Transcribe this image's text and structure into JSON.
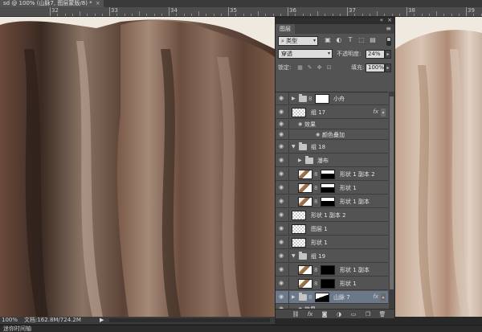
{
  "document_tab": {
    "title": "sd @ 100% (山脉7, 图层蒙版/8) *",
    "close": "×"
  },
  "ruler": {
    "labels": [
      "32",
      "33",
      "34",
      "35",
      "36",
      "37",
      "38",
      "39"
    ]
  },
  "status": {
    "zoom": "100%",
    "doc_info": "文档:162.8M/724.2M",
    "arrow": "▶"
  },
  "bottom_tabs": [
    "迷你",
    "时间轴"
  ],
  "layers_panel": {
    "tab_label": "图层",
    "menu_icon": "≡",
    "filter": {
      "kind_label": "类型",
      "icons": [
        "image-filter-icon",
        "adjustment-filter-icon",
        "text-filter-icon",
        "shape-filter-icon",
        "smart-object-filter-icon"
      ]
    },
    "blend_mode": "穿透",
    "opacity_label": "不透明度:",
    "opacity_value": "24%",
    "lock_label": "锁定:",
    "fill_label": "填充:",
    "fill_value": "100%",
    "layers": [
      {
        "name": "小舟",
        "type": "group",
        "collapsed": true,
        "indent": 0,
        "thumb": "white",
        "has_mask": true
      },
      {
        "name": "组 17",
        "type": "layer",
        "indent": 0,
        "thumb": "checker",
        "fx": "fx"
      },
      {
        "name": "效果",
        "type": "effect-header",
        "indent": 0
      },
      {
        "name": "颜色叠加",
        "type": "effect",
        "indent": 0
      },
      {
        "name": "组 18",
        "type": "group",
        "collapsed": false,
        "indent": 0
      },
      {
        "name": "瀑布",
        "type": "group",
        "collapsed": true,
        "indent": 1
      },
      {
        "name": "形状 1 副本 2",
        "type": "layer",
        "indent": 1,
        "thumb": "art",
        "mask": "shape"
      },
      {
        "name": "形状 1",
        "type": "layer",
        "indent": 1,
        "thumb": "art",
        "mask": "shape"
      },
      {
        "name": "形状 1 副本",
        "type": "layer",
        "indent": 1,
        "thumb": "art",
        "mask": "shape"
      },
      {
        "name": "形状 1 副本 2",
        "type": "layer",
        "indent": 0,
        "thumb": "checker"
      },
      {
        "name": "图层 1",
        "type": "layer",
        "indent": 0,
        "thumb": "checker"
      },
      {
        "name": "形状 1",
        "type": "layer",
        "indent": 0,
        "thumb": "checker"
      },
      {
        "name": "组 19",
        "type": "group",
        "collapsed": false,
        "indent": 0
      },
      {
        "name": "形状 1 副本",
        "type": "layer",
        "indent": 1,
        "thumb": "art",
        "mask": "black"
      },
      {
        "name": "形状 1",
        "type": "layer",
        "indent": 1,
        "thumb": "art",
        "mask": "black"
      },
      {
        "name": "山脉 7",
        "type": "group",
        "collapsed": true,
        "indent": 0,
        "thumb": "mtn",
        "selected": true,
        "fx": "fx"
      },
      {
        "name": "效果",
        "type": "effect-header",
        "indent": 0
      },
      {
        "name": "颜色叠加",
        "type": "effect",
        "indent": 0
      },
      {
        "name": "图层 0",
        "type": "layer",
        "indent": 0,
        "thumb": "plain"
      }
    ],
    "footer_icons": [
      "link-icon",
      "fx-icon",
      "mask-icon",
      "adjustment-icon",
      "folder-icon",
      "new-layer-icon",
      "trash-icon"
    ]
  },
  "colors": {
    "selected_row": "#6b788a",
    "panel_bg": "#535353"
  }
}
